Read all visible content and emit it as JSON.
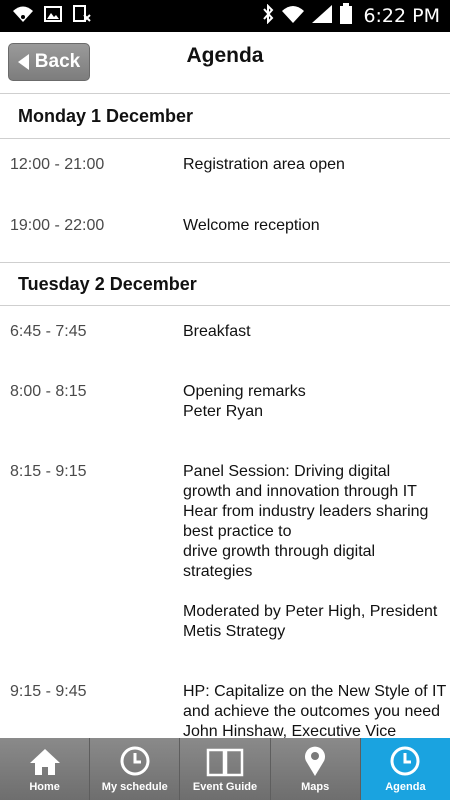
{
  "status_bar": {
    "time": "6:22 PM"
  },
  "header": {
    "back_label": "Back",
    "title": "Agenda"
  },
  "days": [
    {
      "label": "Monday 1 December",
      "items": [
        {
          "time": "12:00 - 21:00",
          "text": "Registration area open"
        },
        {
          "time": "19:00 - 22:00",
          "text": "Welcome reception"
        }
      ]
    },
    {
      "label": "Tuesday 2 December",
      "items": [
        {
          "time": "6:45 - 7:45",
          "text": "Breakfast"
        },
        {
          "time": "8:00 - 8:15",
          "text": "Opening remarks\nPeter Ryan"
        },
        {
          "time": "8:15 - 9:15",
          "text": "Panel Session: Driving digital\ngrowth and innovation through IT\nHear from industry leaders sharing\nbest practice to\ndrive growth through digital\nstrategies\n\nModerated by Peter High, President\nMetis Strategy"
        },
        {
          "time": "9:15 - 9:45",
          "text": "HP: Capitalize on the New Style of IT\nand achieve the outcomes you need\nJohn Hinshaw, Executive Vice"
        }
      ]
    }
  ],
  "tabs": [
    {
      "label": "Home",
      "icon": "home-icon",
      "active": false
    },
    {
      "label": "My schedule",
      "icon": "clock-icon",
      "active": false
    },
    {
      "label": "Event Guide",
      "icon": "book-icon",
      "active": false
    },
    {
      "label": "Maps",
      "icon": "map-pin-icon",
      "active": false
    },
    {
      "label": "Agenda",
      "icon": "clock-icon",
      "active": true
    }
  ],
  "colors": {
    "active_tab": "#1aa3e0",
    "tab_bar": "#7a7a7a",
    "back_button": "#8a8a8a"
  }
}
